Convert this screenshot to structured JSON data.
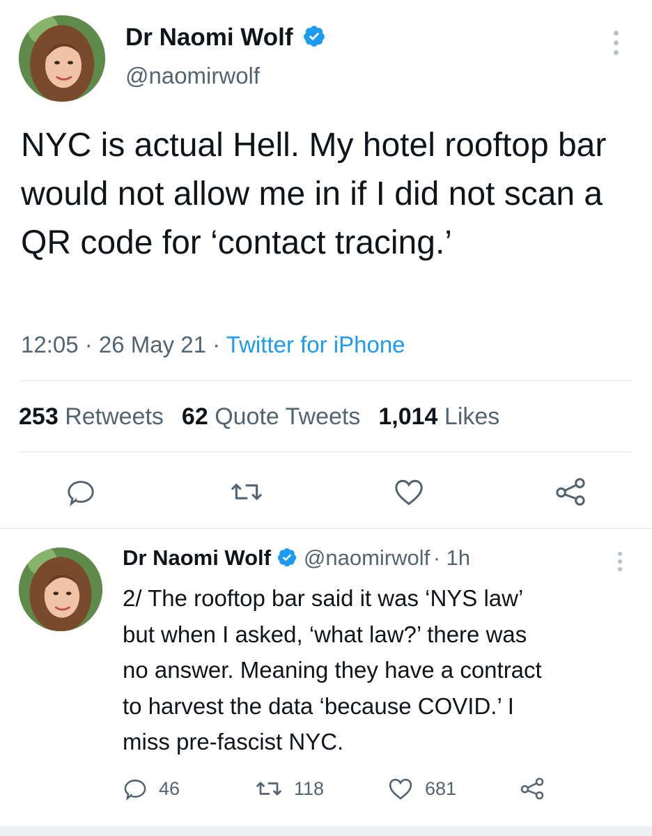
{
  "tweet": {
    "author_name": "Dr Naomi Wolf",
    "author_handle": "@naomirwolf",
    "text": "NYC is actual Hell. My hotel rooftop bar would not allow me in if I did not scan a QR code for ‘contact tracing.’",
    "time": "12:05",
    "date": "26 May 21",
    "source": "Twitter for iPhone",
    "separator": " · ",
    "stats": {
      "retweets_count": "253",
      "retweets_label": "Retweets",
      "quotes_count": "62",
      "quotes_label": "Quote Tweets",
      "likes_count": "1,014",
      "likes_label": "Likes"
    },
    "icons": [
      "reply-icon",
      "retweet-icon",
      "like-icon",
      "share-icon"
    ]
  },
  "reply": {
    "author_name": "Dr Naomi Wolf",
    "author_handle": "@naomirwolf",
    "time_ago": "· 1h",
    "text_lines": [
      "2/ The rooftop bar said it was ‘NYS law’",
      "but when I asked, ‘what law?’ there was",
      "no answer. Meaning they have a contract",
      "to harvest the data ‘because COVID.’ I",
      "miss pre-fascist NYC."
    ],
    "actions": {
      "replies": "46",
      "retweets": "118",
      "likes": "681"
    }
  },
  "colors": {
    "accent": "#1d9bf0",
    "text": "#0f1419",
    "secondary": "#536471",
    "divider": "#e1e6ea"
  }
}
